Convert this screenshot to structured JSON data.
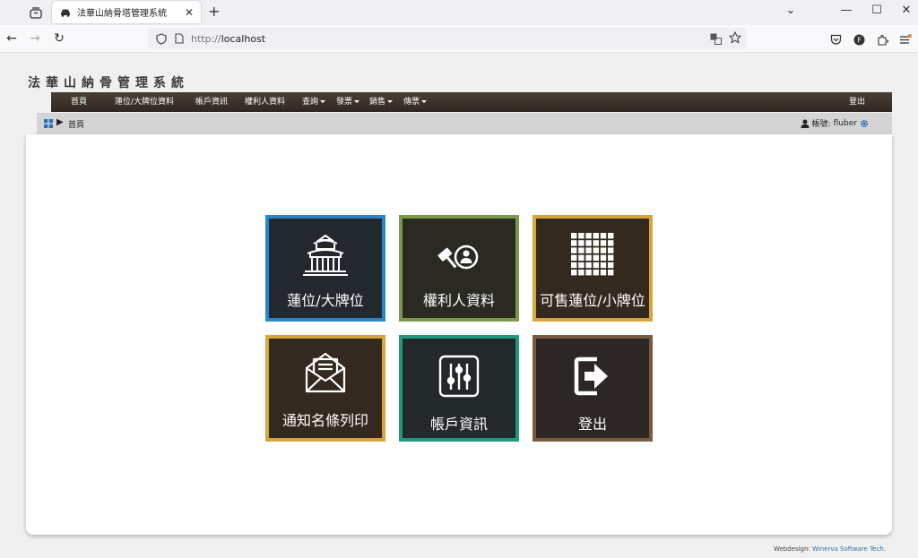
{
  "browser": {
    "tab_title": "法華山納骨塔管理系統",
    "tab_close": "✕",
    "new_tab": "+",
    "url_protocol": "http://",
    "url_host": "localhost",
    "window_controls": [
      "⌄",
      "—",
      "☐",
      "✕"
    ]
  },
  "site": {
    "title": "法華山納骨管理系統"
  },
  "menu": {
    "items": [
      {
        "label": "首頁",
        "dropdown": false
      },
      {
        "label": "蓮位/大牌位資料",
        "dropdown": false
      },
      {
        "label": "帳戶資訊",
        "dropdown": false
      },
      {
        "label": "權利人資料",
        "dropdown": false
      },
      {
        "label": "查詢",
        "dropdown": true
      },
      {
        "label": "發票",
        "dropdown": true
      },
      {
        "label": "銷售",
        "dropdown": true
      },
      {
        "label": "傳票",
        "dropdown": true
      }
    ],
    "logout": "登出"
  },
  "breadcrumb": {
    "separator": "▶",
    "current": "首頁"
  },
  "account": {
    "label": "帳號:",
    "username": "fluber"
  },
  "tiles": [
    {
      "label": "蓮位/大牌位",
      "icon": "temple-icon",
      "border": "#2a86c8",
      "bg": "#23282e"
    },
    {
      "label": "權利人資料",
      "icon": "owner-gavel-icon",
      "border": "#7a9a4a",
      "bg": "#2b2a22"
    },
    {
      "label": "可售蓮位/小牌位",
      "icon": "grid-icon",
      "border": "#d4a63c",
      "bg": "#34291e"
    },
    {
      "label": "通知名條列印",
      "icon": "envelope-letter-icon",
      "border": "#d4a63c",
      "bg": "#34291e"
    },
    {
      "label": "帳戶資訊",
      "icon": "sliders-icon",
      "border": "#1f9a7c",
      "bg": "#23282a"
    },
    {
      "label": "登出",
      "icon": "logout-icon",
      "border": "#7a5a3e",
      "bg": "#2c2724"
    }
  ],
  "footer": {
    "prefix": "Webdesign:",
    "link": "Winerva Software Tech."
  }
}
